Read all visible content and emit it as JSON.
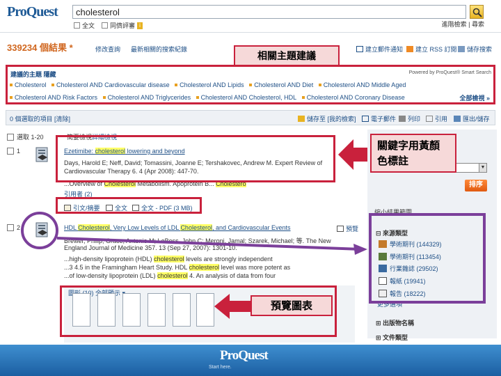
{
  "header": {
    "logo": "ProQuest",
    "search_value": "cholesterol",
    "opt_fulltext": "全文",
    "opt_peer": "同儕評審",
    "top_links": "進階檢索  |  尋索"
  },
  "results": {
    "count": "339234 個結果 *",
    "modify_search": "修改查詢",
    "recent_searches": "最新相關的搜索紀錄",
    "create_alert": "建立郵件通知",
    "create_rss": "建立 RSS 訂閱",
    "save_search": "儲存搜索"
  },
  "related": {
    "heading": "建議的主題  隱藏",
    "powered_by": "Powered by ProQuest® Smart Search",
    "row1": [
      "Cholesterol",
      "Cholesterol AND Cardiovascular disease",
      "Cholesterol AND Lipids",
      "Cholesterol AND Diet",
      "Cholesterol AND Middle Aged"
    ],
    "row2": [
      "Cholesterol AND Risk Factors",
      "Cholesterol AND Triglycerides",
      "Cholesterol AND Cholesterol, HDL",
      "Cholesterol AND Coronary Disease"
    ],
    "view_all": "全部檢視 »"
  },
  "callouts": {
    "related_topics": "相關主題建議",
    "keyword_highlight": "關鍵字用黃顏色標註",
    "preview_charts": "預覽圖表"
  },
  "selection": {
    "selected_text": "0 個選取的項目 [清除]",
    "save_to": "儲存至 [我的檢索]",
    "email": "電子郵件",
    "print": "列印",
    "cite": "引用",
    "export": "匯出/儲存"
  },
  "list_header": {
    "select_label": "選取 1-20",
    "brief_view": "簡要檢視",
    "detail_view": "詳細檢視"
  },
  "result1": {
    "num": "1",
    "title_pre": "Ezetimibe: ",
    "title_hl": "cholesterol",
    "title_post": " lowering and beyond",
    "meta1": "Days, Harold E; Neff, David; Tomassini, Joanne E; Tershakovec, Andrew M. Expert Review of",
    "meta2": "Cardiovascular Therapy 6. 4 (Apr 2008): 447-70.",
    "more_pre": "...Overview of ",
    "more_hl": "Cholesterol",
    "more_mid": " Metabolism. Apoprotein B... ",
    "more_hl2": "Cholestero",
    "cited": "引用者 (2)",
    "link_abstract": "引文/摘要",
    "link_fulltext": "全文",
    "link_pdf": "全文 - PDF (3 MB)"
  },
  "result2": {
    "num": "2",
    "title_a": "HDL ",
    "title_hl1": "Cholesterol",
    "title_b": ", Very Low Levels of LDL ",
    "title_hl2": "Cholesterol",
    "title_c": ", and Cardiovascular Events",
    "meta1": "Brewer, Philip; Grace, Antonio M; LeBoss, John C; Meroni, Jamal; Szarek, Michael; 等. The New",
    "meta2": "England Journal of Medicine 357. 13  (Sep 27, 2007): 1301-10.",
    "more1_pre": "...high-density lipoprotein (HDL) ",
    "more1_hl": "cholesterol",
    "more1_post": " levels are strongly independent",
    "more2_pre": "...3 4.5 in the Framingham Heart Study. HDL ",
    "more2_hl": "cholesterol",
    "more2_post": " level was more potent as",
    "more3_pre": "...of low-density lipoprotein (LDL) ",
    "more3_hl": "cholesterol",
    "more3_post": " 4. An analysis of data from four",
    "preview": "預覽",
    "graphs_label": "圖形 (10)  全部顯示 ▾"
  },
  "sidebar": {
    "narrow_title": "縮小結果範圍",
    "source_type": "來源類型",
    "sources": [
      {
        "label": "學術期刊 (144329)",
        "icon": "journal-icon"
      },
      {
        "label": "學術期刊 (113454)",
        "icon": "scholarly-journal-icon"
      },
      {
        "label": "行業雜誌 (29502)",
        "icon": "trade-journal-icon"
      },
      {
        "label": "報紙 (19941)",
        "icon": "newspaper-icon"
      },
      {
        "label": "報告 (18222)",
        "icon": "report-icon"
      }
    ],
    "more_options": "更多選項",
    "filter_button": "排序",
    "publication_title": "出版物名稱",
    "document_type": "文件類型"
  },
  "footer": {
    "logo": "ProQuest",
    "text": "Start here."
  }
}
